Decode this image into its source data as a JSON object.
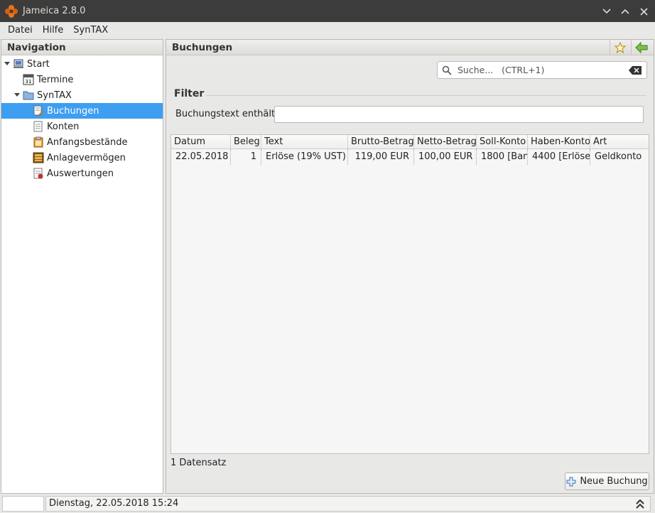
{
  "window": {
    "title": "Jameica 2.8.0"
  },
  "menu": [
    "Datei",
    "Hilfe",
    "SynTAX"
  ],
  "navigation": {
    "header": "Navigation",
    "items": [
      {
        "label": "Start",
        "icon": "computer-icon"
      },
      {
        "label": "Termine",
        "icon": "calendar-icon"
      },
      {
        "label": "SynTAX",
        "icon": "folder-icon"
      },
      {
        "label": "Buchungen",
        "icon": "document-pen-icon",
        "selected": true
      },
      {
        "label": "Konten",
        "icon": "document-icon"
      },
      {
        "label": "Anfangsbestände",
        "icon": "clipboard-icon"
      },
      {
        "label": "Anlagevermögen",
        "icon": "ledger-icon"
      },
      {
        "label": "Auswertungen",
        "icon": "report-icon"
      }
    ]
  },
  "main": {
    "header": "Buchungen",
    "search_placeholder": "Suche...   (CTRL+1)",
    "filter": {
      "title": "Filter",
      "label": "Buchungstext enthält",
      "value": ""
    },
    "table": {
      "columns": [
        "Datum",
        "Beleg",
        "Text",
        "Brutto-Betrag",
        "Netto-Betrag",
        "Soll-Konto",
        "Haben-Konto",
        "Art"
      ],
      "rows": [
        [
          "22.05.2018",
          "1",
          "Erlöse (19% UST)",
          "119,00 EUR",
          "100,00 EUR",
          "1800 [Ban",
          "4400 [Erlöse",
          "Geldkonto"
        ]
      ]
    },
    "record_count": "1 Datensatz",
    "new_button": "Neue Buchung"
  },
  "statusbar": {
    "datetime": "Dienstag, 22.05.2018 15:24"
  },
  "colors": {
    "selection": "#3d9ef2",
    "titlebar": "#3c3c3c",
    "accent_orange": "#e9731c"
  }
}
